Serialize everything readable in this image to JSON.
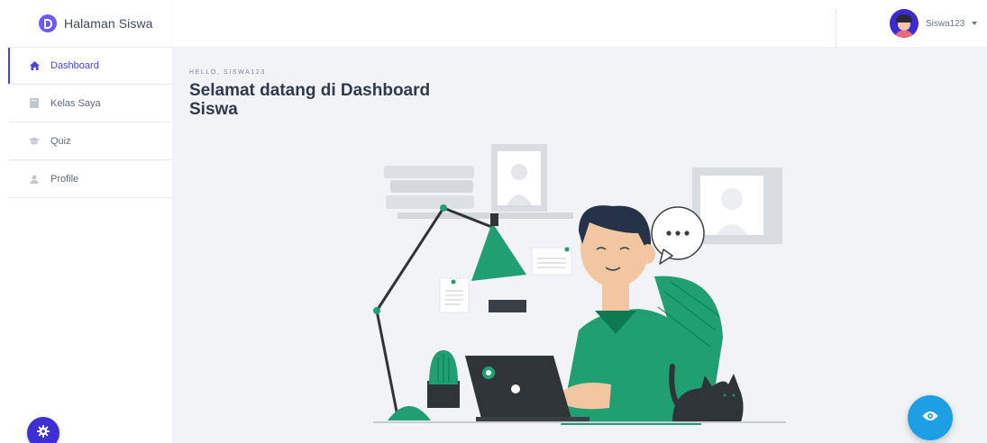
{
  "brand": {
    "name": "Halaman Siswa"
  },
  "sidebar": {
    "items": [
      {
        "label": "Dashboard",
        "icon": "home-icon",
        "active": true
      },
      {
        "label": "Kelas Saya",
        "icon": "book-icon",
        "active": false
      },
      {
        "label": "Quiz",
        "icon": "graduation-cap-icon",
        "active": false
      },
      {
        "label": "Profile",
        "icon": "user-icon",
        "active": false
      }
    ]
  },
  "header": {
    "user": {
      "name": "Siswa123"
    }
  },
  "main": {
    "greeting": "HELLO, SISWA123",
    "title": "Selamat datang di Dashboard Siswa"
  },
  "fabs": {
    "settings_icon": "gear-icon",
    "view_icon": "eye-icon"
  },
  "colors": {
    "accent": "#4b46d6",
    "brand": "#6a5af9",
    "fab_blue": "#1e9ee4",
    "illustration_green": "#1f9f72"
  }
}
